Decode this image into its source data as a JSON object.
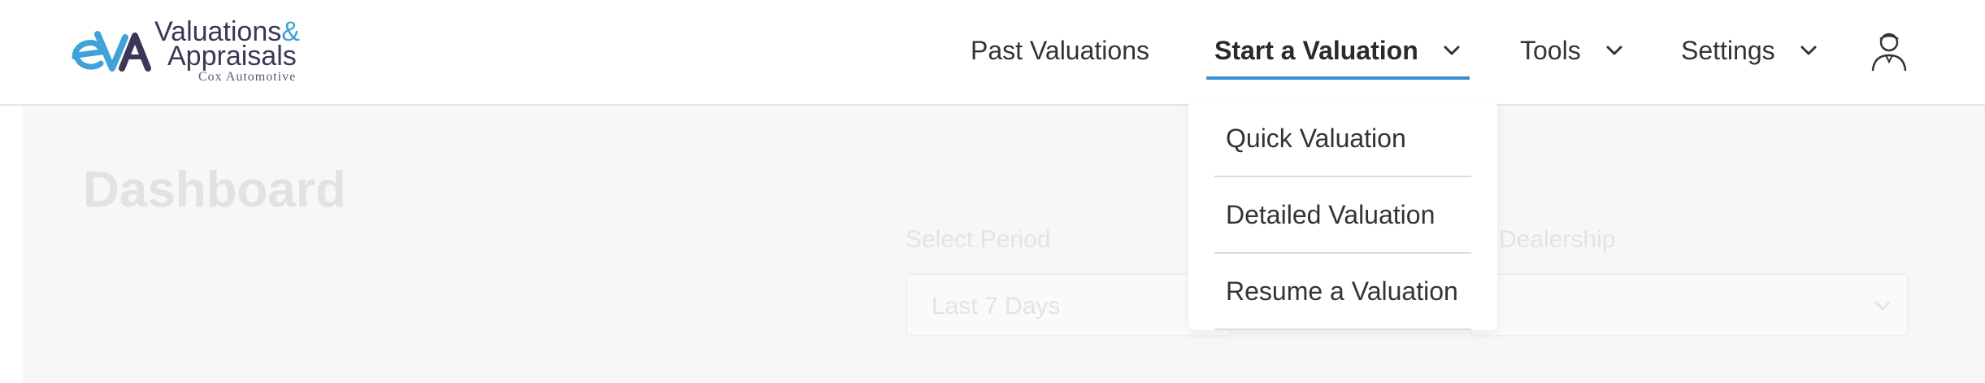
{
  "brand": {
    "mark_text": "eVA",
    "line1": "Valuations",
    "line1_amp": "&",
    "line2": "Appraisals",
    "line3": "Cox Automotive",
    "colors": {
      "blue": "#3fa2d8",
      "navy": "#3b3756"
    }
  },
  "nav": {
    "items": [
      {
        "label": "Past Valuations",
        "has_dropdown": false,
        "active": false
      },
      {
        "label": "Start a Valuation",
        "has_dropdown": true,
        "active": true
      },
      {
        "label": "Tools",
        "has_dropdown": true,
        "active": false
      },
      {
        "label": "Settings",
        "has_dropdown": true,
        "active": false
      }
    ],
    "user_icon": "user-avatar-icon",
    "accent_color": "#3b8fd0"
  },
  "dropdown": {
    "items": [
      {
        "label": "Quick Valuation"
      },
      {
        "label": "Detailed Valuation"
      },
      {
        "label": "Resume a Valuation"
      }
    ]
  },
  "page": {
    "title": "Dashboard",
    "filters": [
      {
        "label": "Select Period",
        "value": "Last 7 Days"
      },
      {
        "label": "Dealership",
        "value": ""
      }
    ]
  }
}
